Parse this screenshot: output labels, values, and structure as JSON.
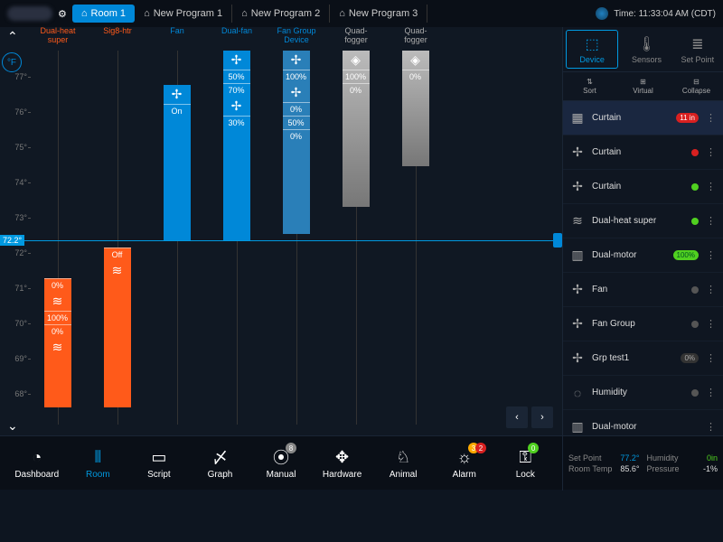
{
  "top": {
    "tabs": [
      "Room 1",
      "New Program 1",
      "New Program 2",
      "New Program 3"
    ],
    "active_tab": 0,
    "time_label": "Time: 11:33:04 AM (CDT)"
  },
  "yaxis": {
    "unit": "°F",
    "ticks": [
      "77°",
      "76°",
      "75°",
      "74°",
      "73°",
      "72°",
      "71°",
      "70°",
      "69°",
      "68°"
    ],
    "setpoint": "72.2°",
    "setpoint_pos_pct": 52
  },
  "chart_data": {
    "type": "bar",
    "ylim": [
      67,
      78
    ],
    "setpoint": 72.2,
    "devices": [
      {
        "name": "Dual-heat super",
        "class": "heat",
        "top_temp": 71.3,
        "bottom_temp": 67.5,
        "segments": [
          {
            "label": "0%"
          },
          {
            "icon": "heat"
          },
          {
            "label": "100%"
          },
          {
            "label": "0%"
          },
          {
            "icon": "heat"
          }
        ],
        "color": "#ff5a1a"
      },
      {
        "name": "Sig8-htr",
        "class": "heat",
        "top_temp": 72.2,
        "bottom_temp": 67.5,
        "segments": [
          {
            "label": "Off"
          },
          {
            "icon": "heat"
          }
        ],
        "color": "#ff5a1a"
      },
      {
        "name": "Fan",
        "class": "fan",
        "top_temp": 77.0,
        "bottom_temp": 72.4,
        "segments": [
          {
            "icon": "fan"
          },
          {
            "label": "On"
          }
        ],
        "color": "#0088d8"
      },
      {
        "name": "Dual-fan",
        "class": "fan",
        "top_temp": 78.0,
        "bottom_temp": 72.4,
        "segments": [
          {
            "icon": "fan"
          },
          {
            "label": "50%"
          },
          {
            "label": "70%"
          },
          {
            "icon": "fan"
          },
          {
            "label": "30%"
          }
        ],
        "color": "#0088d8"
      },
      {
        "name": "Fan Group Device",
        "class": "fan",
        "top_temp": 78.0,
        "bottom_temp": 72.6,
        "segments": [
          {
            "icon": "fan"
          },
          {
            "label": "100%"
          },
          {
            "icon": "fan"
          },
          {
            "label": "0%"
          },
          {
            "label": "50%"
          },
          {
            "label": "0%"
          }
        ],
        "color": "#2a7fb8"
      },
      {
        "name": "Quad-fogger",
        "class": "fog",
        "top_temp": 78.0,
        "bottom_temp": 73.4,
        "segments": [
          {
            "icon": "fog"
          },
          {
            "label": "100%"
          },
          {
            "label": "0%"
          }
        ],
        "color": "#888"
      },
      {
        "name": "Quad-fogger",
        "class": "fog",
        "top_temp": 78.0,
        "bottom_temp": 74.6,
        "segments": [
          {
            "icon": "fog"
          },
          {
            "label": "0%"
          }
        ],
        "color": "#999"
      }
    ]
  },
  "sidebar": {
    "tabs": [
      "Device",
      "Sensors",
      "Set Point"
    ],
    "tools": [
      "Sort",
      "Virtual",
      "Collapse"
    ],
    "devices": [
      {
        "icon": "curtain",
        "name": "Curtain",
        "badge": "11 in",
        "badge_class": "badge-red",
        "active": true
      },
      {
        "icon": "fan",
        "name": "Curtain",
        "badge": "",
        "badge_class": "badge-red-dot"
      },
      {
        "icon": "fan",
        "name": "Curtain",
        "badge": "",
        "badge_class": "badge-green-dot"
      },
      {
        "icon": "heat",
        "name": "Dual-heat super",
        "badge": "",
        "badge_class": "badge-green-dot"
      },
      {
        "icon": "motor",
        "name": "Dual-motor",
        "badge": "100%",
        "badge_class": "badge-green"
      },
      {
        "icon": "fan",
        "name": "Fan",
        "badge": "",
        "badge_class": "badge-grey-dot"
      },
      {
        "icon": "fan",
        "name": "Fan Group",
        "badge": "",
        "badge_class": "badge-grey-dot"
      },
      {
        "icon": "fan",
        "name": "Grp test1",
        "badge": "0%",
        "badge_class": "badge-grey"
      },
      {
        "icon": "humidity",
        "name": "Humidity",
        "badge": "",
        "badge_class": "badge-grey-dot"
      },
      {
        "icon": "motor",
        "name": "Dual-motor",
        "badge": "",
        "badge_class": ""
      }
    ]
  },
  "nav": {
    "items": [
      {
        "label": "Dashboard",
        "icon": "◔"
      },
      {
        "label": "Room",
        "icon": "⦀",
        "active": true
      },
      {
        "label": "Script",
        "icon": "▭"
      },
      {
        "label": "Graph",
        "icon": "〆"
      },
      {
        "label": "Manual",
        "icon": "⦿",
        "badge": "8",
        "badge_bg": "#888"
      },
      {
        "label": "Hardware",
        "icon": "✥"
      },
      {
        "label": "Animal",
        "icon": "♘"
      },
      {
        "label": "Alarm",
        "icon": "☼",
        "badge": "3",
        "badge_bg": "#ffaa00",
        "badge2": "2",
        "badge2_bg": "#d82020"
      },
      {
        "label": "Lock",
        "icon": "⚿",
        "badge": "0",
        "badge_bg": "#50d020"
      }
    ]
  },
  "status": {
    "setpoint_label": "Set Point",
    "setpoint_val": "77.2°",
    "humidity_label": "Humidity",
    "humidity_val": "0in",
    "roomtemp_label": "Room Temp",
    "roomtemp_val": "85.6°",
    "pressure_label": "Pressure",
    "pressure_val": "-1%"
  }
}
